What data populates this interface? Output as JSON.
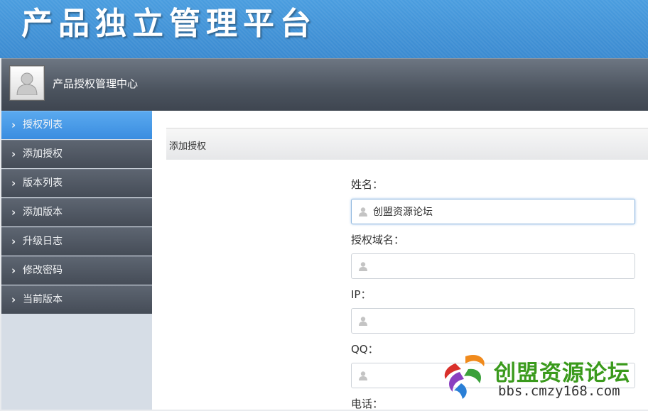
{
  "banner": {
    "title": "产品独立管理平台"
  },
  "userbar": {
    "title": "产品授权管理中心"
  },
  "sidebar": {
    "items": [
      {
        "label": "授权列表",
        "active": true
      },
      {
        "label": "添加授权"
      },
      {
        "label": "版本列表"
      },
      {
        "label": "添加版本"
      },
      {
        "label": "升级日志"
      },
      {
        "label": "修改密码"
      },
      {
        "label": "当前版本"
      }
    ]
  },
  "panel": {
    "title": "添加授权",
    "fields": [
      {
        "label": "姓名：",
        "value": "创盟资源论坛"
      },
      {
        "label": "授权域名：",
        "value": ""
      },
      {
        "label": "IP：",
        "value": ""
      },
      {
        "label": "QQ：",
        "value": ""
      },
      {
        "label": "电话：",
        "value": ""
      }
    ]
  },
  "watermark": {
    "name": "创盟资源论坛",
    "url": "bbs.cmzy168.com"
  },
  "colors": {
    "accent": "#3a8de0",
    "banner": "#3f92d6",
    "nav": "#4f5762"
  }
}
